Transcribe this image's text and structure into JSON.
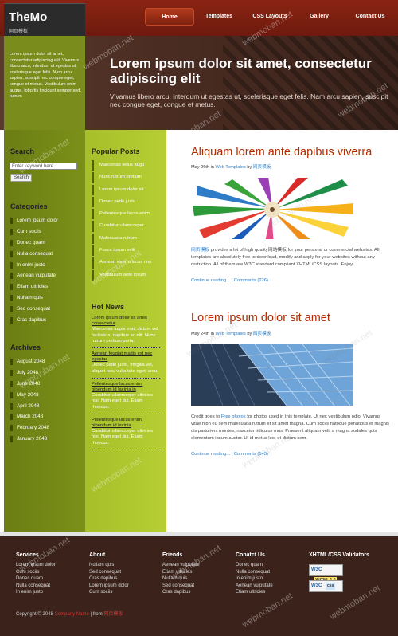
{
  "brand": {
    "title": "TheMo",
    "subtitle": "网页模板"
  },
  "nav": [
    {
      "label": "Home",
      "active": true
    },
    {
      "label": "Templates"
    },
    {
      "label": "CSS Layouts"
    },
    {
      "label": "Gallery"
    },
    {
      "label": "Contact Us"
    }
  ],
  "hero": {
    "side_text": "Lorem ipsum dolor sit amet, consectetur adipiscing elit. Vivamus libero arcu, interdum ut egestas ut, scelerisque eget felis. Nam arcu sapien, suscipit nec congue eget, congue et metus. Vestibulum enim augue, lobortis tincidunt semper sed, rutrum",
    "title": "Lorem ipsum dolor sit amet, consectetur adipiscing elit",
    "subtitle": "Vivamus libero arcu, interdum ut egestas ut, scelerisque eget felis. Nam arcu sapien, suscipit nec congue eget, congue et metus."
  },
  "search": {
    "heading": "Search",
    "placeholder": "Enter keyword here...",
    "button": "Search"
  },
  "categories": {
    "heading": "Categories",
    "items": [
      "Lorem ipsum dolor",
      "Cum sociis",
      "Donec quam",
      "Nulla consequat",
      "In enim justo",
      "Aenean vulputate",
      "Etiam ultricies",
      "Nullam quis",
      "Sed consequat",
      "Cras dapibus"
    ]
  },
  "archives": {
    "heading": "Archives",
    "items": [
      "August 2048",
      "July 2048",
      "June 2048",
      "May 2048",
      "April 2048",
      "March 2048",
      "February 2048",
      "January 2048"
    ]
  },
  "popular": {
    "heading": "Popular Posts",
    "items": [
      "Maecenas tellus augu",
      "Nunc rutrum pretium",
      "Lorem ipsum dolor sit",
      "Donec pede justo",
      "Pellentesque lacus enim",
      "Curabitur ullamcorper",
      "Malesuada rutrum",
      "Fusce ipsum velit",
      "Aenean viverra lacus non",
      "Vestibulum ante ipsum"
    ]
  },
  "hot": {
    "heading": "Hot News",
    "items": [
      {
        "title": "Lorem ipsum dolor sit amet consectetur",
        "text": "Maecenas turpis erat, dictum vel facilisis a, dapibus ac elit. Nunc rutrum pretium porta."
      },
      {
        "title": "Aenean feugiat mattis est nec egestas",
        "text": "Donec pede justo, fringilla vel, aliquet nec, vulputate eget, arcu."
      },
      {
        "title": "Pellentesque lacus enim, bibendum id lacinia in",
        "text": "Curabitur ullamcorper ultricies nisi. Nam eget dui. Etiam rhoncus."
      },
      {
        "title": "Pellentesque lacus enim, bibendum id lacinia",
        "text": "Curabitur ullamcorper ultricies nisi. Nam eget dui. Etiam rhoncus."
      }
    ]
  },
  "posts": [
    {
      "title": "Aliquam lorem ante dapibus viverra",
      "date": "May 26th in",
      "category": "Web Templates",
      "by": "by",
      "author": "网页模板",
      "text_link": "网页模板",
      "text": "provides a lot of high quality网站模板 for your personal or commercial websites. All templates are absolutely free to download, modify and apply for your websites without any restriction. All of them are W3C standard compliant XHTML/CSS layouts. Enjoy!",
      "continue": "Continue reading...",
      "sep": "|",
      "comments": "Comments (226)"
    },
    {
      "title": "Lorem ipsum dolor sit amet",
      "date": "May 24th in",
      "category": "Web Templates",
      "by": "by",
      "author": "网页模板",
      "text_pre": "Credit goes to",
      "text_link": "Free photos",
      "text": "for photos used in this template. Ut nec vestibulum odio. Vivamus vitae nibh eu sem malesuada rutrum et sit amet magna. Cum sociis natoque penatibus et magnis dis parturient montes, nascetur ridiculus mus. Praesent aliquam velit a magna sodales quis elementum ipsum auctor. Ut id metus leo, et dictum sem.",
      "continue": "Continue reading...",
      "sep": "|",
      "comments": "Comments (145)"
    }
  ],
  "footer": {
    "columns": [
      {
        "heading": "Services",
        "items": [
          "Lorem ipsum dolor",
          "Cum sociis",
          "Donec quam",
          "Nulla consequat",
          "In enim justo"
        ]
      },
      {
        "heading": "About",
        "items": [
          "Nullam quis",
          "Sed consequat",
          "Cras dapibus",
          "Lorem ipsum dolor",
          "Cum sociis"
        ]
      },
      {
        "heading": "Friends",
        "items": [
          "Aenean vulputate",
          "Etiam ultricies",
          "Nullam quis",
          "Sed consequat",
          "Cras dapibus"
        ]
      },
      {
        "heading": "Conatct Us",
        "items": [
          "Donec quam",
          "Nulla consequat",
          "In enim justo",
          "Aenean vulputate",
          "Etiam ultricies"
        ]
      }
    ],
    "validators_heading": "XHTML/CSS Validators",
    "badge_xhtml": {
      "w3c": "W3C",
      "label": "XHTML",
      "version": "1.0"
    },
    "badge_css": {
      "w3c": "W3C",
      "label": "css"
    },
    "copyright_pre": "Copyright © 2048",
    "company": "Company Name",
    "from": "| from",
    "from_link": "网页模板"
  },
  "watermark": "webmoban.net",
  "colors": {
    "header": "#8a2412",
    "olive_dark": "#6b7d14",
    "olive_light": "#b7cf34",
    "title_red": "#b12b00",
    "link_blue": "#2a7bc4",
    "footer": "#3b221a"
  }
}
